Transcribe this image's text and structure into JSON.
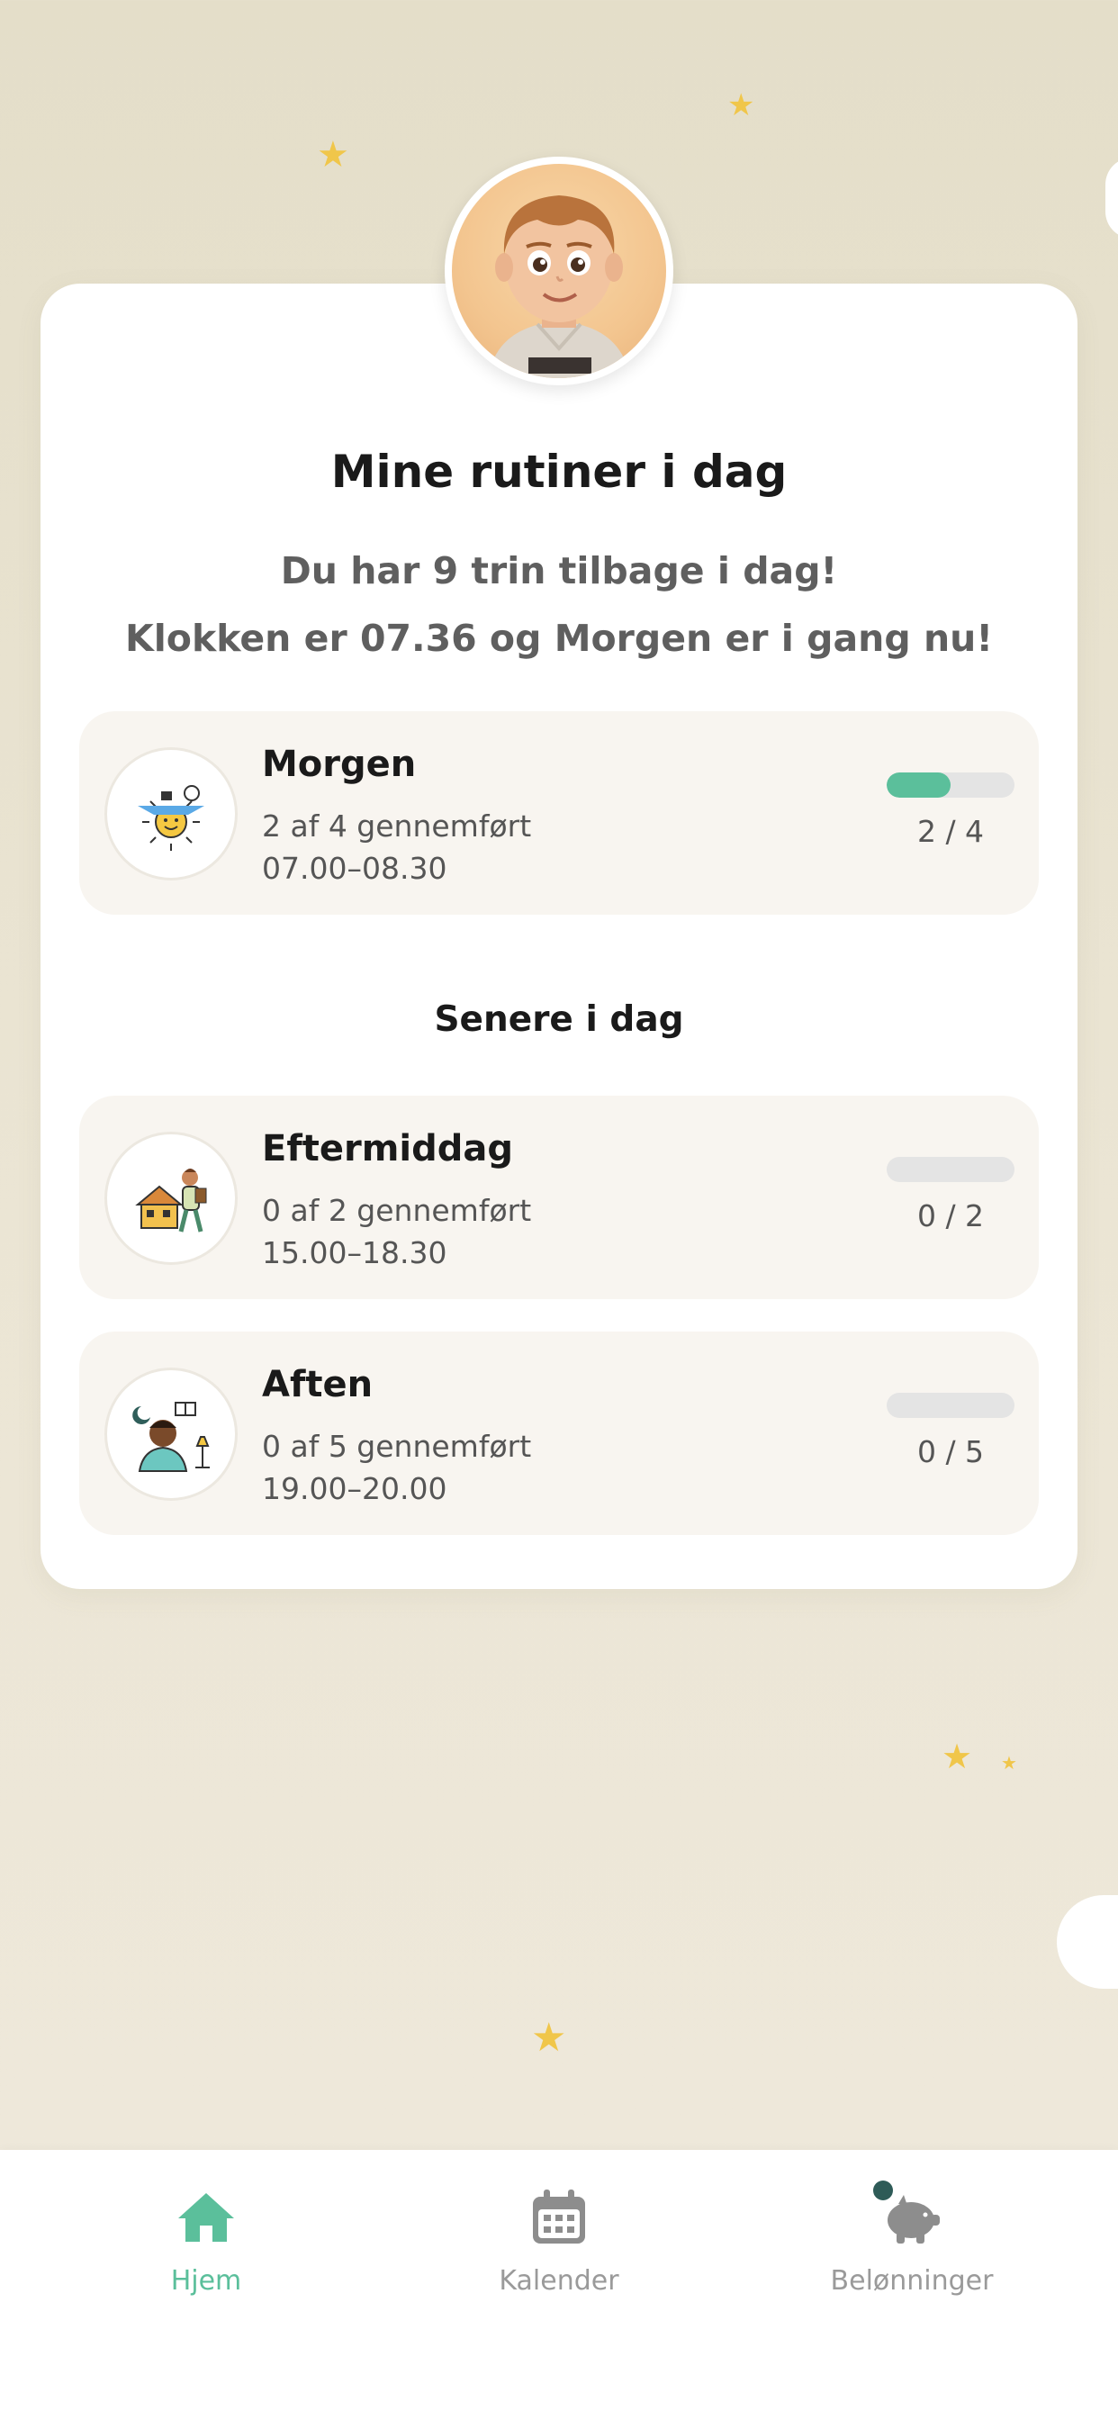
{
  "header": {
    "title": "Mine rutiner i dag",
    "steps_left": "Du har 9 trin tilbage i dag!",
    "status": "Klokken er 07.36 og Morgen er i gang nu!"
  },
  "current": {
    "name": "Morgen",
    "done": "2 af 4 gennemført",
    "time": "07.00–08.30",
    "count": "2 / 4",
    "progress": 0.5,
    "icon": "morning-sun-icon"
  },
  "later": {
    "section_title": "Senere i dag",
    "items": [
      {
        "name": "Eftermiddag",
        "done": "0 af 2 gennemført",
        "time": "15.00–18.30",
        "count": "0 / 2",
        "progress": 0,
        "icon": "afternoon-house-icon"
      },
      {
        "name": "Aften",
        "done": "0 af 5 gennemført",
        "time": "19.00–20.00",
        "count": "0 / 5",
        "progress": 0,
        "icon": "evening-moon-icon"
      }
    ]
  },
  "nav": {
    "items": [
      {
        "label": "Hjem",
        "icon": "home-icon",
        "active": true
      },
      {
        "label": "Kalender",
        "icon": "calendar-icon",
        "active": false
      },
      {
        "label": "Belønninger",
        "icon": "piggy-bank-icon",
        "active": false
      }
    ]
  },
  "colors": {
    "accent": "#5bbf9b",
    "background": "#e4dec9",
    "card": "#ffffff",
    "routine_bg": "#f8f5f0",
    "star": "#f0c64a",
    "notification_dot": "#2e5b57"
  }
}
